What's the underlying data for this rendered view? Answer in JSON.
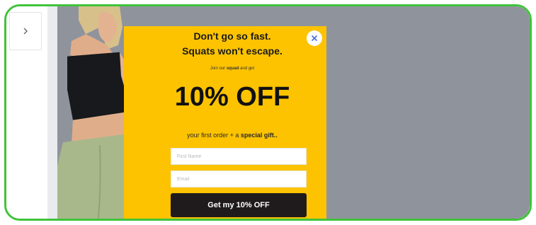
{
  "sidebar": {
    "expand_icon": "chevron-right-icon"
  },
  "popup": {
    "headline_line1": "Don't go so fast.",
    "headline_line2": "Squats won't escape.",
    "subline_prefix": "Join our",
    "subline_bold": "squad",
    "subline_suffix": "and get",
    "discount": "10% OFF",
    "offer_prefix": "your first order + a",
    "offer_bold": "special gift..",
    "first_name_placeholder": "First Name",
    "email_placeholder": "Email",
    "cta_label": "Get my 10% OFF",
    "close_icon": "close-icon",
    "accent_color": "#fdc300",
    "button_color": "#1f1b1c"
  },
  "colors": {
    "frame_border": "#3fc43a",
    "overlay": "#8f949c"
  }
}
